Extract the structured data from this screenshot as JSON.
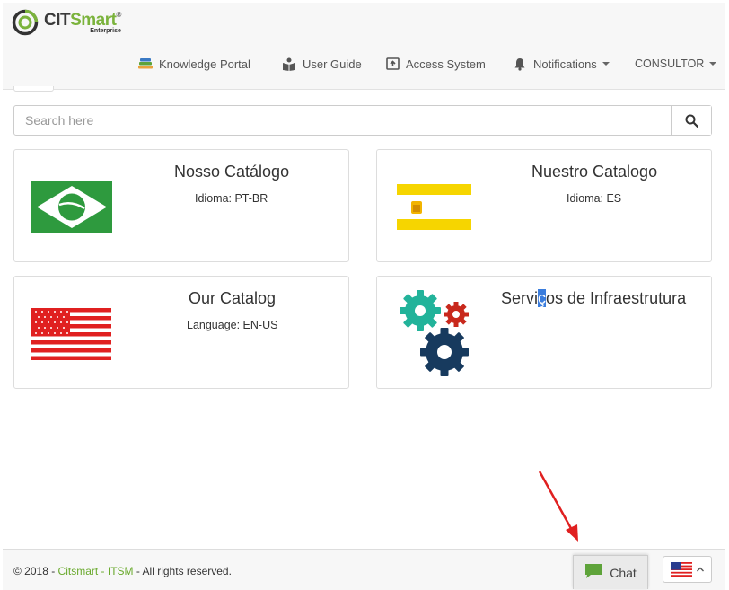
{
  "brand": {
    "name_part1": "CIT",
    "name_part2": "Smart",
    "registered": "®",
    "edition": "Enterprise"
  },
  "nav": {
    "knowledge_portal": "Knowledge Portal",
    "user_guide": "User Guide",
    "access_system": "Access System",
    "notifications": "Notifications",
    "user": "CONSULTOR"
  },
  "search": {
    "placeholder": "Search here",
    "value": ""
  },
  "catalogs": [
    {
      "title": "Nosso Catálogo",
      "subtitle": "Idioma: PT-BR",
      "flag": "brazil-flag"
    },
    {
      "title": "Nuestro Catalogo",
      "subtitle": "Idioma: ES",
      "flag": "spain-flag"
    },
    {
      "title": "Our Catalog",
      "subtitle": "Language: EN-US",
      "flag": "usa-flag"
    },
    {
      "title_before": "Servi",
      "title_selected": "ç",
      "title_after": "os de Infraestrutura",
      "subtitle": "",
      "icon": "gears-icon"
    }
  ],
  "footer": {
    "copyright_prefix": "© 2018 - ",
    "company_link": "Citsmart - ITSM",
    "copyright_suffix": " - All rights reserved.",
    "chat_label": "Chat",
    "language_flag": "usa-flag"
  },
  "colors": {
    "brand_green": "#7bb33c",
    "link_green": "#6aaa2e",
    "chat_green": "#5ea33a",
    "selection_blue": "#3b7ddd",
    "arrow_red": "#e02020"
  }
}
